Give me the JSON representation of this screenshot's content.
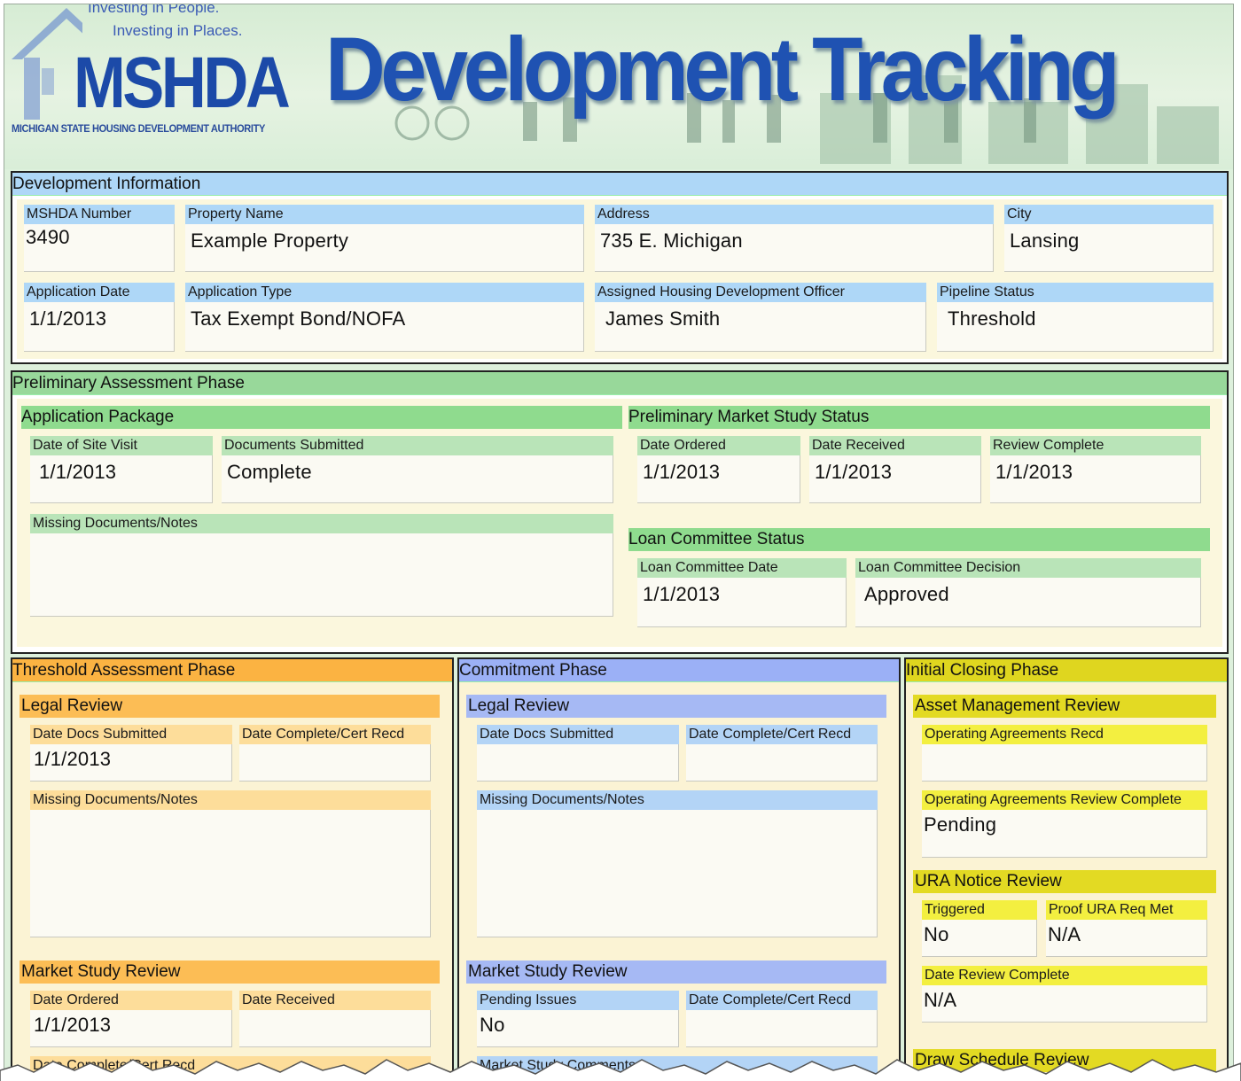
{
  "header": {
    "tagline_1": "Investing in People.",
    "tagline_2": "Investing in Places.",
    "logo": "MSHDA",
    "logo_subtitle": "MICHIGAN STATE HOUSING DEVELOPMENT AUTHORITY",
    "title": "Development Tracking"
  },
  "development_information": {
    "title": "Development Information",
    "mshda_number": {
      "label": "MSHDA Number",
      "value": "3490"
    },
    "property_name": {
      "label": "Property Name",
      "value": "Example Property"
    },
    "address": {
      "label": "Address",
      "value": "735 E. Michigan"
    },
    "city": {
      "label": "City",
      "value": "Lansing"
    },
    "application_date": {
      "label": "Application Date",
      "value": "1/1/2013"
    },
    "application_type": {
      "label": "Application Type",
      "value": "Tax Exempt Bond/NOFA"
    },
    "officer": {
      "label": "Assigned Housing Development Officer",
      "value": "James Smith"
    },
    "pipeline_status": {
      "label": "Pipeline Status",
      "value": "Threshold"
    }
  },
  "preliminary": {
    "title": "Preliminary Assessment Phase",
    "application_package": {
      "title": "Application Package",
      "site_visit": {
        "label": "Date of Site Visit",
        "value": "1/1/2013"
      },
      "documents": {
        "label": "Documents Submitted",
        "value": "Complete"
      },
      "notes": {
        "label": "Missing Documents/Notes",
        "value": ""
      }
    },
    "market_study": {
      "title": "Preliminary Market Study Status",
      "ordered": {
        "label": "Date Ordered",
        "value": "1/1/2013"
      },
      "received": {
        "label": "Date Received",
        "value": "1/1/2013"
      },
      "complete": {
        "label": "Review Complete",
        "value": "1/1/2013"
      }
    },
    "loan_committee": {
      "title": "Loan Committee Status",
      "date": {
        "label": "Loan Committee Date",
        "value": "1/1/2013"
      },
      "decision": {
        "label": "Loan Committee Decision",
        "value": "Approved"
      }
    }
  },
  "threshold": {
    "title": "Threshold Assessment Phase",
    "legal_review": {
      "title": "Legal Review",
      "docs_submitted": {
        "label": "Date Docs Submitted",
        "value": "1/1/2013"
      },
      "complete": {
        "label": "Date Complete/Cert Recd",
        "value": ""
      },
      "notes": {
        "label": "Missing Documents/Notes",
        "value": ""
      }
    },
    "market_study": {
      "title": "Market Study Review",
      "ordered": {
        "label": "Date Ordered",
        "value": "1/1/2013"
      },
      "received": {
        "label": "Date Received",
        "value": ""
      },
      "cut_label": "Date Complete/Cert Recd"
    }
  },
  "commitment": {
    "title": "Commitment Phase",
    "legal_review": {
      "title": "Legal Review",
      "docs_submitted": {
        "label": "Date Docs Submitted",
        "value": ""
      },
      "complete": {
        "label": "Date Complete/Cert Recd",
        "value": ""
      },
      "notes": {
        "label": "Missing Documents/Notes",
        "value": ""
      }
    },
    "market_study": {
      "title": "Market Study Review",
      "pending": {
        "label": "Pending Issues",
        "value": "No"
      },
      "complete": {
        "label": "Date Complete/Cert Recd",
        "value": ""
      },
      "cut_label": "Market Study Comments"
    }
  },
  "initial_closing": {
    "title": "Initial Closing Phase",
    "asset_management": {
      "title": "Asset Management Review",
      "op_recd": {
        "label": "Operating Agreements Recd",
        "value": ""
      },
      "op_complete": {
        "label": "Operating Agreements Review Complete",
        "value": "Pending"
      }
    },
    "ura": {
      "title": "URA Notice Review",
      "triggered": {
        "label": "Triggered",
        "value": "No"
      },
      "proof": {
        "label": "Proof URA Req Met",
        "value": "N/A"
      },
      "review_complete": {
        "label": "Date Review Complete",
        "value": "N/A"
      }
    },
    "draw_schedule": {
      "title": "Draw Schedule Review"
    }
  },
  "colors": {
    "info": "#aed7f7",
    "preliminary": "#98d89a",
    "threshold": "#fbb342",
    "commitment": "#9bb0f6",
    "initial_closing": "#dfd61f",
    "title_blue": "#1f52b2"
  }
}
